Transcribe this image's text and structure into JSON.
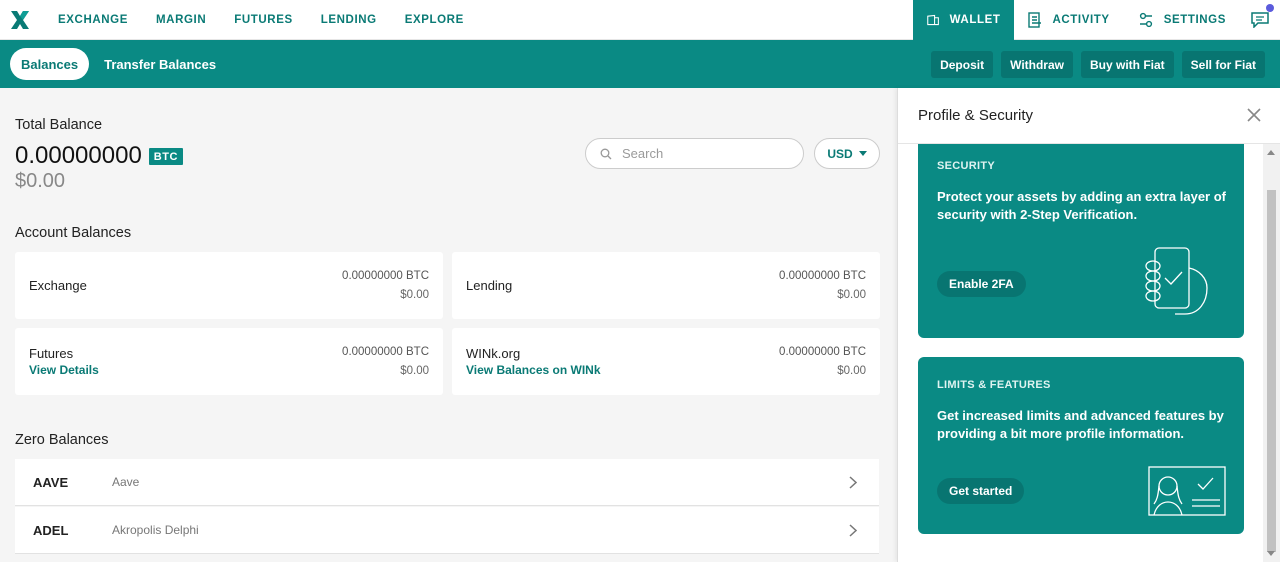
{
  "topnav": {
    "links": [
      "EXCHANGE",
      "MARGIN",
      "FUTURES",
      "LENDING",
      "EXPLORE"
    ],
    "wallet": "WALLET",
    "activity": "ACTIVITY",
    "settings": "SETTINGS"
  },
  "subnav": {
    "balances_tab": "Balances",
    "transfer_tab": "Transfer Balances",
    "actions": [
      "Deposit",
      "Withdraw",
      "Buy with Fiat",
      "Sell for Fiat"
    ]
  },
  "total": {
    "label": "Total Balance",
    "btc": "0.00000000",
    "badge": "BTC",
    "usd": "$0.00"
  },
  "search": {
    "placeholder": "Search"
  },
  "currency": "USD",
  "account_balances": {
    "title": "Account Balances",
    "cards": [
      {
        "name": "Exchange",
        "btc": "0.00000000 BTC",
        "usd": "$0.00",
        "link": ""
      },
      {
        "name": "Lending",
        "btc": "0.00000000 BTC",
        "usd": "$0.00",
        "link": ""
      },
      {
        "name": "Futures",
        "btc": "0.00000000 BTC",
        "usd": "$0.00",
        "link": "View Details"
      },
      {
        "name": "WINk.org",
        "btc": "0.00000000 BTC",
        "usd": "$0.00",
        "link": "View Balances on WINk"
      }
    ]
  },
  "zero_balances": {
    "title": "Zero Balances",
    "rows": [
      {
        "symbol": "AAVE",
        "name": "Aave"
      },
      {
        "symbol": "ADEL",
        "name": "Akropolis Delphi"
      }
    ]
  },
  "panel": {
    "title": "Profile & Security",
    "security": {
      "kicker": "SECURITY",
      "text": "Protect your assets by adding an extra layer of security with 2-Step Verification.",
      "button": "Enable 2FA"
    },
    "limits": {
      "kicker": "LIMITS & FEATURES",
      "text": "Get increased limits and advanced features by providing a bit more profile information.",
      "button": "Get started"
    }
  },
  "colors": {
    "brand": "#0a8a84",
    "brand_dark": "#087571",
    "link": "#0a7a75"
  }
}
